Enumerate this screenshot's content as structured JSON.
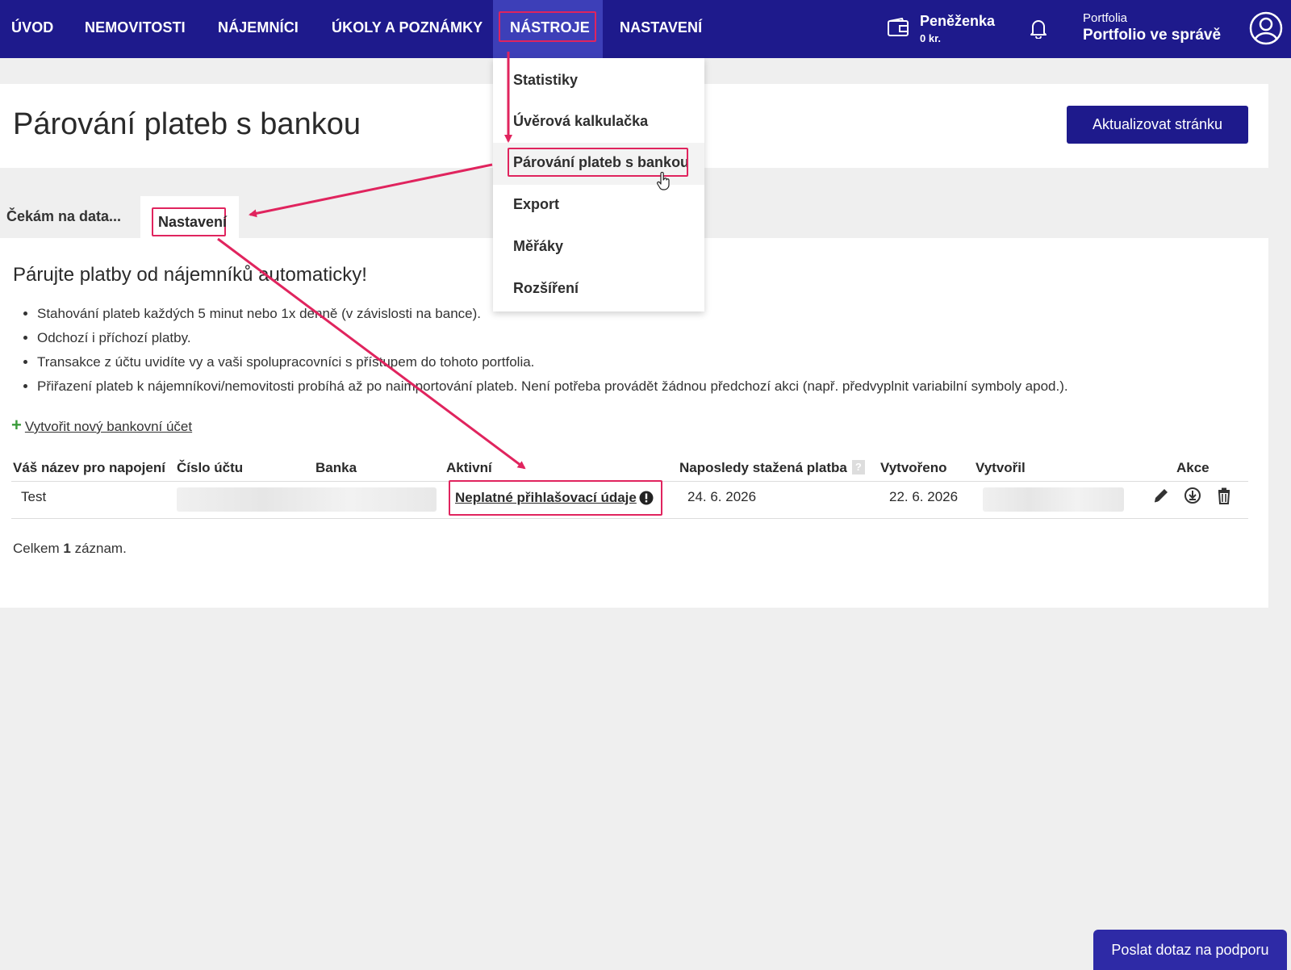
{
  "nav": {
    "items": [
      "ÚVOD",
      "NEMOVITOSTI",
      "NÁJEMNÍCI",
      "ÚKOLY A POZNÁMKY",
      "NÁSTROJE",
      "NASTAVENÍ"
    ],
    "active": "NÁSTROJE",
    "wallet_title": "Peněženka",
    "wallet_amount": "0 kr.",
    "portfolio_label": "Portfolia",
    "portfolio_name": "Portfolio ve správě"
  },
  "header": {
    "title": "Párování plateb s bankou",
    "refresh_button": "Aktualizovat stránku"
  },
  "tabs": {
    "waiting": "Čekám na data...",
    "settings": "Nastavení"
  },
  "dropdown": {
    "items": [
      "Statistiky",
      "Úvěrová kalkulačka",
      "Párování plateb s bankou",
      "Export",
      "Měřáky",
      "Rozšíření"
    ],
    "selected": "Párování plateb s bankou"
  },
  "content": {
    "title": "Párujte platby od nájemníků automaticky!",
    "bullets": [
      "Stahování plateb každých 5 minut nebo 1x denně (v závislosti na bance).",
      "Odchozí i příchozí platby.",
      "Transakce z účtu uvidíte vy a vaši spolupracovníci s přístupem do tohoto portfolia.",
      "Přiřazení plateb k nájemníkovi/nemovitosti probíhá až po naimportování plateb. Není potřeba provádět žádnou předchozí akci (např. předvyplnit variabilní symboly apod.)."
    ],
    "add_account": "Vytvořit nový bankovní účet"
  },
  "table": {
    "columns": {
      "name": "Váš název pro napojení",
      "account_number": "Číslo účtu",
      "bank": "Banka",
      "active": "Aktivní",
      "last_payment": "Naposledy stažená platba",
      "last_payment_help": "?",
      "created": "Vytvořeno",
      "created_by": "Vytvořil",
      "actions": "Akce"
    },
    "rows": [
      {
        "name": "Test",
        "status": "Neplatné přihlašovací údaje",
        "last_payment": "24. 6. 2026",
        "created": "22. 6. 2026"
      }
    ],
    "total_prefix": "Celkem",
    "total_count": "1",
    "total_suffix": "záznam."
  },
  "support_button": "Poslat dotaz na podporu",
  "colors": {
    "nav_bg": "#1e1a8c",
    "nav_active_bg": "#3d3fb8",
    "highlight": "#e0245e",
    "add_icon": "#3a9b3a"
  },
  "icons": [
    "wallet-icon",
    "bell-icon",
    "user-icon",
    "warning-icon",
    "edit-icon",
    "download-icon",
    "trash-icon",
    "pointer-hand-icon",
    "plus-icon"
  ]
}
